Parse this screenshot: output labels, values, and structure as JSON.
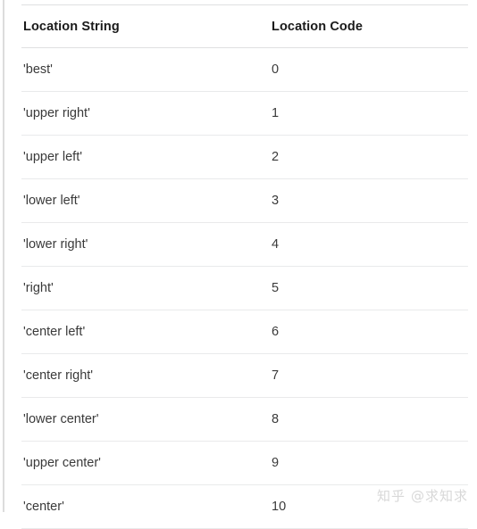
{
  "page": {
    "watermark_logo": "知乎",
    "watermark_handle": "@求知求"
  },
  "table": {
    "columns": [
      {
        "key": "location_string",
        "label": "Location String"
      },
      {
        "key": "location_code",
        "label": "Location Code"
      }
    ],
    "rows": [
      {
        "location_string": "'best'",
        "location_code": "0"
      },
      {
        "location_string": "'upper right'",
        "location_code": "1"
      },
      {
        "location_string": "'upper left'",
        "location_code": "2"
      },
      {
        "location_string": "'lower left'",
        "location_code": "3"
      },
      {
        "location_string": "'lower right'",
        "location_code": "4"
      },
      {
        "location_string": "'right'",
        "location_code": "5"
      },
      {
        "location_string": "'center left'",
        "location_code": "6"
      },
      {
        "location_string": "'center right'",
        "location_code": "7"
      },
      {
        "location_string": "'lower center'",
        "location_code": "8"
      },
      {
        "location_string": "'upper center'",
        "location_code": "9"
      },
      {
        "location_string": "'center'",
        "location_code": "10"
      }
    ]
  },
  "colors": {
    "header_text": "#1a1a1a",
    "body_text": "#3a3a3a",
    "row_border": "#e9eaeb",
    "header_border": "#dfe0e1",
    "watermark": "#d8d8d8",
    "background": "#ffffff"
  }
}
